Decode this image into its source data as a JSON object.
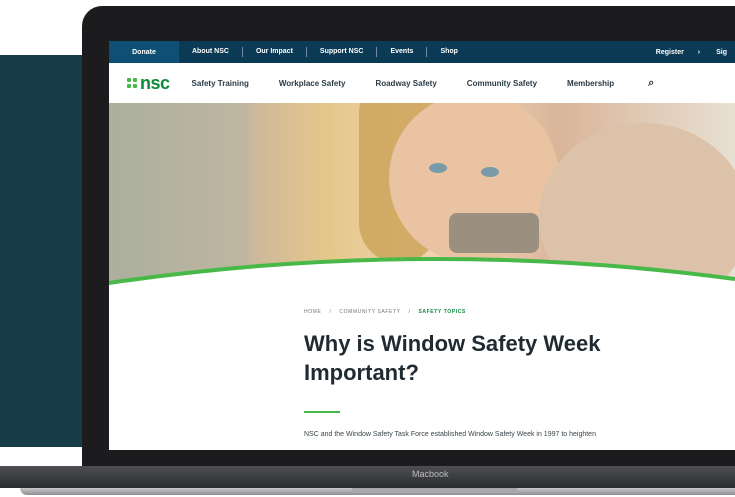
{
  "device": {
    "brand_label": "Macbook"
  },
  "topbar": {
    "donate": "Donate",
    "links": [
      "About NSC",
      "Our Impact",
      "Support NSC",
      "Events",
      "Shop"
    ],
    "register": "Register",
    "register_arrow": "›",
    "signin": "Sig"
  },
  "nav": {
    "logo": "nsc",
    "items": [
      "Safety Training",
      "Workplace Safety",
      "Roadway Safety",
      "Community Safety",
      "Membership"
    ],
    "search_glyph": "⌕"
  },
  "hero": {
    "accent_color": "#48b848"
  },
  "article": {
    "breadcrumb": [
      "HOME",
      "COMMUNITY SAFETY",
      "SAFETY TOPICS"
    ],
    "breadcrumb_sep": "/",
    "title": "Why is Window Safety Week Important?",
    "intro": "NSC and the Window Safety Task Force established Window Safety Week in 1997 to heighten"
  },
  "colors": {
    "topbar": "#0b3a55",
    "brand_green": "#0c8a3e",
    "panel": "#173c48"
  }
}
